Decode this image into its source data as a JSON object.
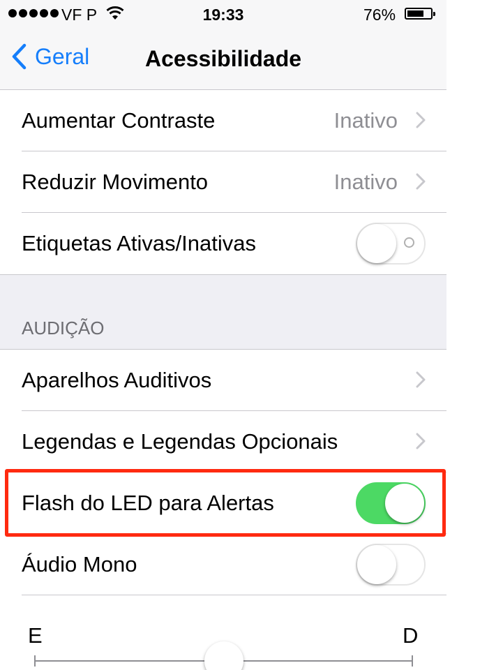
{
  "status_bar": {
    "carrier": "VF P",
    "time": "19:33",
    "battery_percent_label": "76%",
    "battery_level": 0.76,
    "signal_bars": 5
  },
  "nav": {
    "back_label": "Geral",
    "title": "Acessibilidade"
  },
  "group1": {
    "rows": [
      {
        "label": "Aumentar Contraste",
        "value": "Inativo"
      },
      {
        "label": "Reduzir Movimento",
        "value": "Inativo"
      },
      {
        "label": "Etiquetas Ativas/Inativas",
        "toggle_on": false
      }
    ]
  },
  "hearing": {
    "section_title": "AUDIÇÃO",
    "rows": [
      {
        "label": "Aparelhos Auditivos"
      },
      {
        "label": "Legendas e Legendas Opcionais"
      },
      {
        "label": "Flash do LED para Alertas",
        "toggle_on": true,
        "highlighted": true
      },
      {
        "label": "Áudio Mono",
        "toggle_on": false
      }
    ]
  },
  "balance": {
    "left_label": "E",
    "right_label": "D",
    "position": 0.5
  },
  "colors": {
    "accent": "#157efb",
    "toggle_on": "#4cd964",
    "highlight_border": "#ff2a10",
    "secondary_text": "#8e8e93"
  }
}
